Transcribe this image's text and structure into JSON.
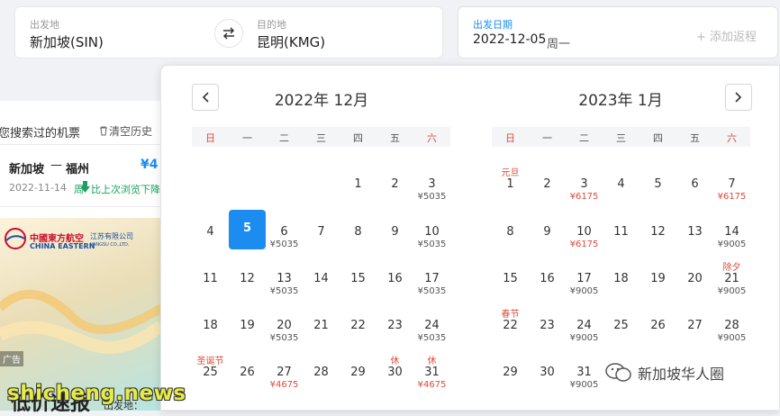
{
  "search": {
    "origin_label": "出发地",
    "origin_value": "新加坡(SIN)",
    "dest_label": "目的地",
    "dest_value": "昆明(KMG)",
    "date_label": "出发日期",
    "date_value": "2022-12-05",
    "date_weekday": "周一",
    "return_label": "+ 添加返程"
  },
  "history": {
    "title": "您搜索过的机票",
    "clear": "清空历史",
    "route_from": "新加坡",
    "route_dash": "—",
    "route_to": "福州",
    "price": "¥4",
    "date": "2022-11-14",
    "note_prefix": "周",
    "note": "比上次浏览下降"
  },
  "ad": {
    "airline_cn": "中國東方航空",
    "airline_en": "CHINA EASTERN",
    "sub_cn": "江苏有限公司",
    "sub_en": "JIANGSU CO.,LTD.",
    "badge": "广告",
    "bottom_text": "低价速报",
    "bottom_sub": "出发地："
  },
  "calendar": {
    "weekdays": [
      "日",
      "一",
      "二",
      "三",
      "四",
      "五",
      "六"
    ],
    "left_month": {
      "title": "2022年 12月",
      "rows": [
        [
          null,
          null,
          null,
          null,
          {
            "d": "1"
          },
          {
            "d": "2"
          },
          {
            "d": "3",
            "p": "¥5035"
          }
        ],
        [
          {
            "d": "4"
          },
          {
            "d": "5",
            "sel": true
          },
          {
            "d": "6",
            "p": "¥5035"
          },
          {
            "d": "7"
          },
          {
            "d": "8"
          },
          {
            "d": "9"
          },
          {
            "d": "10",
            "p": "¥5035"
          }
        ],
        [
          {
            "d": "11"
          },
          {
            "d": "12"
          },
          {
            "d": "13",
            "p": "¥5035"
          },
          {
            "d": "14"
          },
          {
            "d": "15"
          },
          {
            "d": "16"
          },
          {
            "d": "17",
            "p": "¥5035"
          }
        ],
        [
          {
            "d": "18"
          },
          {
            "d": "19"
          },
          {
            "d": "20",
            "p": "¥5035"
          },
          {
            "d": "21"
          },
          {
            "d": "22"
          },
          {
            "d": "23"
          },
          {
            "d": "24",
            "p": "¥5035"
          }
        ],
        [
          {
            "d": "25",
            "t": "圣诞节"
          },
          {
            "d": "26"
          },
          {
            "d": "27",
            "p": "¥4675",
            "red": true
          },
          {
            "d": "28"
          },
          {
            "d": "29"
          },
          {
            "d": "30",
            "t": "休"
          },
          {
            "d": "31",
            "t": "休",
            "p": "¥4675",
            "red": true
          }
        ]
      ]
    },
    "right_month": {
      "title": "2023年 1月",
      "rows": [
        [
          {
            "d": "1",
            "t": "元旦"
          },
          {
            "d": "2"
          },
          {
            "d": "3",
            "p": "¥6175",
            "red": true
          },
          {
            "d": "4"
          },
          {
            "d": "5"
          },
          {
            "d": "6"
          },
          {
            "d": "7",
            "p": "¥6175",
            "red": true
          }
        ],
        [
          {
            "d": "8"
          },
          {
            "d": "9"
          },
          {
            "d": "10",
            "p": "¥6175",
            "red": true
          },
          {
            "d": "11"
          },
          {
            "d": "12"
          },
          {
            "d": "13"
          },
          {
            "d": "14",
            "p": "¥9005"
          }
        ],
        [
          {
            "d": "15"
          },
          {
            "d": "16"
          },
          {
            "d": "17",
            "p": "¥9005"
          },
          {
            "d": "18"
          },
          {
            "d": "19"
          },
          {
            "d": "20"
          },
          {
            "d": "21",
            "t": "除夕",
            "p": "¥9005"
          }
        ],
        [
          {
            "d": "22",
            "t": "春节"
          },
          {
            "d": "23"
          },
          {
            "d": "24",
            "p": "¥9005"
          },
          {
            "d": "25"
          },
          {
            "d": "26"
          },
          {
            "d": "27"
          },
          {
            "d": "28",
            "p": "¥9005"
          }
        ],
        [
          {
            "d": "29"
          },
          {
            "d": "30"
          },
          {
            "d": "31",
            "p": "¥9005"
          },
          null,
          null,
          null,
          null
        ]
      ]
    }
  },
  "watermark": "新加坡华人圈",
  "site_watermark": "shicheng.news",
  "colors": {
    "accent": "#1c8cf0",
    "holiday": "#e04a3a",
    "price_green": "#1aa260"
  }
}
